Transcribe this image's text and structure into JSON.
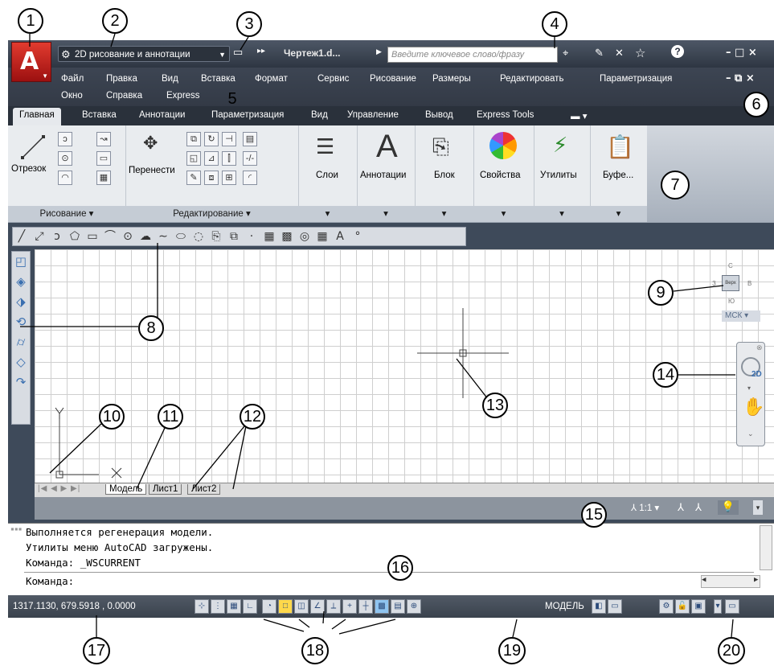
{
  "title_bar": {
    "workspace": "2D рисование и аннотации",
    "doc_title": "Чертеж1.d...",
    "search_placeholder": "Введите ключевое слово/фразу",
    "help_icon": "?",
    "window_controls": "– □ ×",
    "doc_controls": "– ⧉ ×"
  },
  "menu": {
    "row1": [
      "Файл",
      "Правка",
      "Вид",
      "Вставка",
      "Формат",
      "Сервис",
      "Рисование",
      "Размеры",
      "Редактировать",
      "Параметризация"
    ],
    "row2": [
      "Окно",
      "Справка",
      "Express"
    ]
  },
  "ribbon_tabs": [
    "Главная",
    "Вставка",
    "Аннотации",
    "Параметризация",
    "Вид",
    "Управление",
    "Вывод",
    "Express Tools"
  ],
  "ribbon": {
    "draw_panel_label": "Рисование",
    "draw_big_button": "Отрезок",
    "modify_panel_label": "Редактирование",
    "move_button": "Перенести",
    "layers": "Слои",
    "annotations": "Аннотации",
    "block": "Блок",
    "properties": "Свойства",
    "utilities": "Утилиты",
    "clipboard": "Буфе...",
    "annotations_icon": "A"
  },
  "draw_toolbar_text_icon": "A",
  "viewcube": {
    "top": "С",
    "bottom": "Ю",
    "left": "З",
    "right": "В",
    "face": "Верх",
    "ucs": "МСК"
  },
  "navbar_2d": "2D",
  "layout_tabs": [
    "Модель",
    "Лист1",
    "Лист2"
  ],
  "annotation_scale": "1:1",
  "command_lines": [
    "Выполняется регенерация модели.",
    "Утилиты меню AutoCAD загружены.",
    "Команда: _WSCURRENT"
  ],
  "command_prompt": "Команда:",
  "status": {
    "coords": "1317.1130, 679.5918 , 0.0000",
    "space": "МОДЕЛЬ"
  },
  "callouts": [
    "1",
    "2",
    "3",
    "4",
    "5",
    "6",
    "7",
    "8",
    "9",
    "10",
    "11",
    "12",
    "13",
    "14",
    "15",
    "16",
    "17",
    "18",
    "19",
    "20"
  ],
  "ucs_labels": {
    "x": "X",
    "y": "Y"
  }
}
